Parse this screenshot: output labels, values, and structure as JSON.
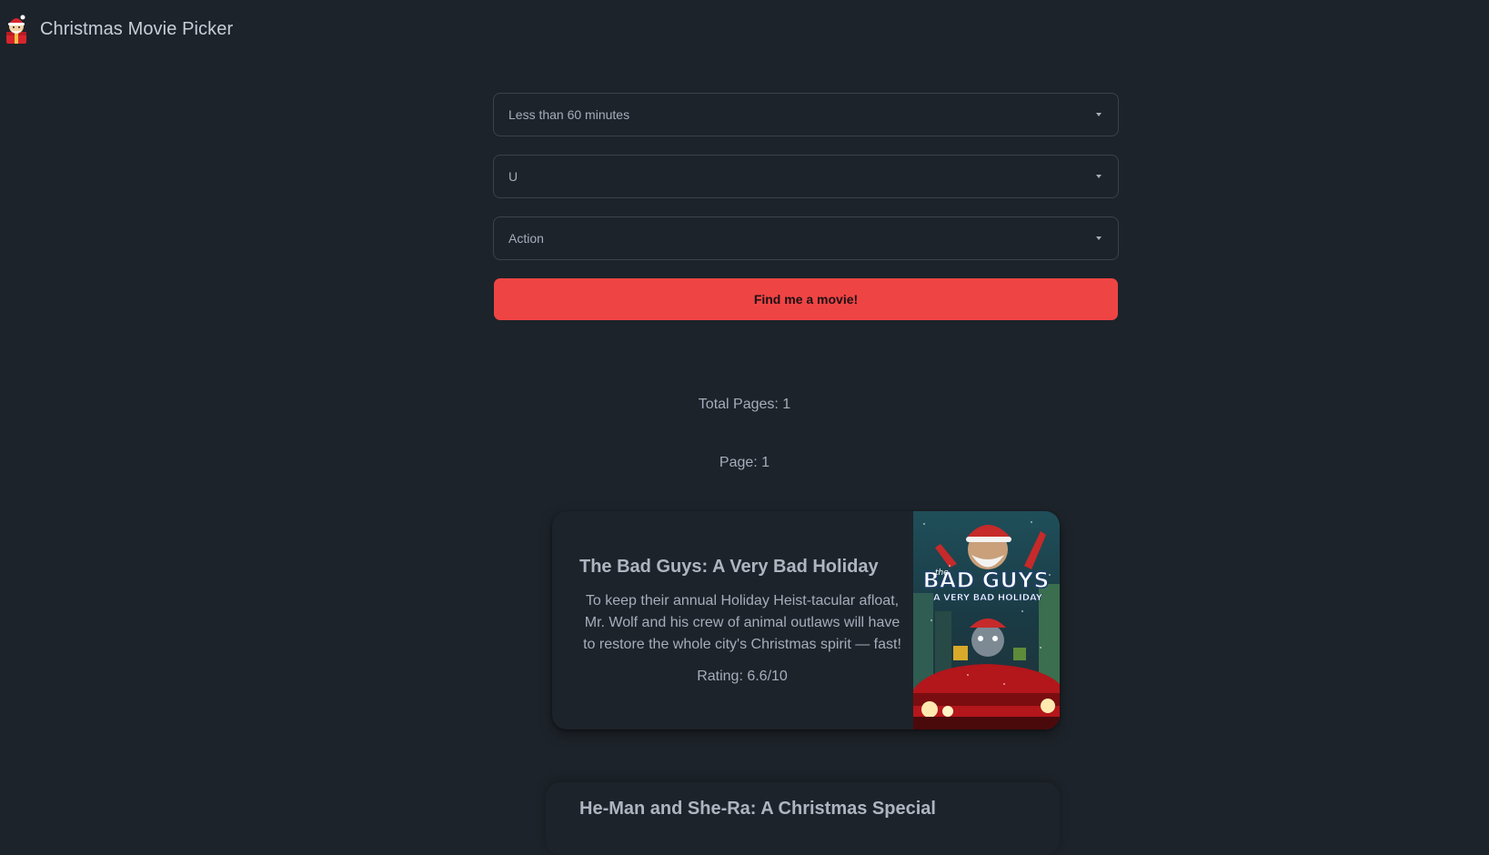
{
  "app": {
    "title": "Christmas Movie Picker"
  },
  "filters": {
    "duration": "Less than 60 minutes",
    "certificate": "U",
    "genre": "Action"
  },
  "search_button_label": "Find me a movie!",
  "pagination": {
    "total_pages": "Total Pages: 1",
    "page": "Page: 1"
  },
  "results": [
    {
      "title": "The Bad Guys: A Very Bad Holiday",
      "description": "To keep their annual Holiday Heist-tacular afloat, Mr. Wolf and his crew of animal outlaws will have to restore the whole city's Christmas spirit — fast!",
      "rating": "Rating: 6.6/10",
      "poster": {
        "title_line_1": "BAD GUYS",
        "title_prefix": "the",
        "title_line_2": "A VERY BAD HOLIDAY"
      }
    },
    {
      "title": "He-Man and She-Ra: A Christmas Special"
    }
  ],
  "colors": {
    "background": "#1d232a",
    "accent": "#ef4444",
    "text": "#a6adbb",
    "border": "#3b424c"
  }
}
